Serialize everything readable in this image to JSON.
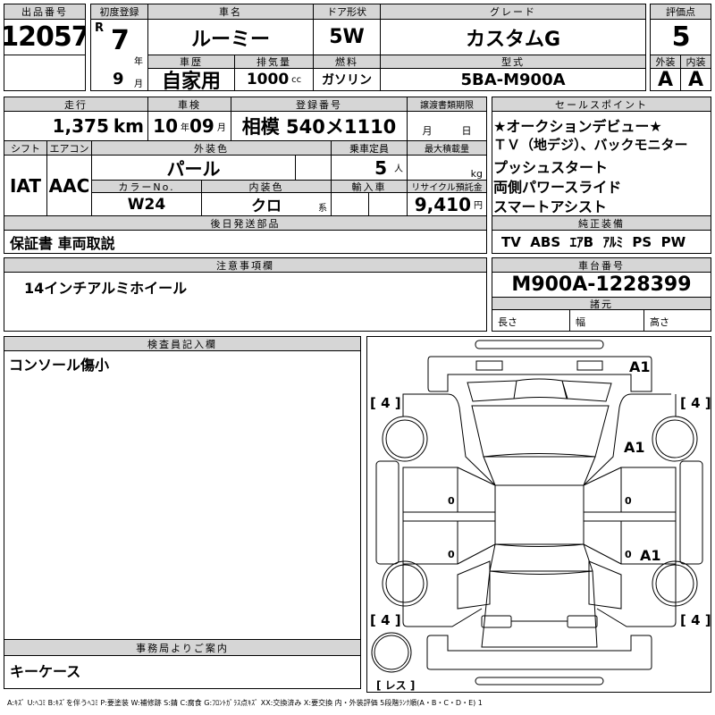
{
  "lot": {
    "label": "出品番号",
    "value": "12057"
  },
  "first_reg": {
    "label": "初度登録",
    "era": "R",
    "year": "7",
    "year_unit": "年",
    "month": "9",
    "month_unit": "月"
  },
  "car_name": {
    "label": "車名",
    "value": "ルーミー"
  },
  "door": {
    "label": "ドア形状",
    "value": "5W"
  },
  "grade": {
    "label": "グレード",
    "value": "カスタムG"
  },
  "history": {
    "label": "車歴",
    "value": "自家用"
  },
  "displacement": {
    "label": "排気量",
    "value": "1000",
    "unit": "cc"
  },
  "fuel": {
    "label": "燃料",
    "value": "ガソリン"
  },
  "model": {
    "label": "型式",
    "value": "5BA-M900A"
  },
  "score": {
    "label": "評価点",
    "value": "5",
    "ext_label": "外装",
    "int_label": "内装",
    "ext": "A",
    "int": "A"
  },
  "mileage": {
    "label": "走行",
    "value": "1,375",
    "unit": "km"
  },
  "inspection": {
    "label": "車検",
    "year": "10",
    "year_unit": "年",
    "month": "09",
    "month_unit": "月"
  },
  "plate": {
    "label": "登録番号",
    "value": "相模 540メ1110"
  },
  "transfer": {
    "label": "譲渡書類期限",
    "month_unit": "月",
    "day_unit": "日"
  },
  "shift": {
    "label": "シフト",
    "value": "IAT"
  },
  "aircon": {
    "label": "エアコン",
    "value": "AAC"
  },
  "ext_color": {
    "label": "外装色",
    "value": "パール"
  },
  "capacity": {
    "label": "乗車定員",
    "value": "5",
    "unit": "人"
  },
  "max_load": {
    "label": "最大積載量",
    "unit": "kg"
  },
  "color_no": {
    "label": "カラーNo.",
    "value": "W24"
  },
  "int_color": {
    "label": "内装色",
    "value": "クロ",
    "unit": "系"
  },
  "import": {
    "label": "輸入車"
  },
  "recycle": {
    "label": "リサイクル預託金",
    "value": "9,410",
    "unit": "円"
  },
  "later_parts": {
    "label": "後日発送部品",
    "value": "保証書 車両取説"
  },
  "sales_points": {
    "label": "セールスポイント",
    "items": [
      "★オークションデビュー★",
      "ＴＶ（地デジ）、バックモニター",
      "プッシュスタート",
      "両側パワースライド",
      "スマートアシスト"
    ]
  },
  "equipment": {
    "label": "純正装備",
    "value": "TV  ABS  ｴｱB  ｱﾙﾐ  PS  PW"
  },
  "notes": {
    "label": "注意事項欄",
    "value": "14インチアルミホイール"
  },
  "chassis": {
    "label": "車台番号",
    "value": "M900A-1228399"
  },
  "specs": {
    "label": "諸元",
    "length": "長さ",
    "width": "幅",
    "height": "高さ"
  },
  "inspector": {
    "label": "検査員記入欄",
    "value": "コンソール傷小"
  },
  "office": {
    "label": "事務局よりご案内",
    "value": "キーケース"
  },
  "diagram": {
    "fl": "[ 4 ]",
    "fr": "[ 4 ]",
    "rl": "[ 4 ]",
    "rr": "[ 4 ]",
    "spare": "[ レス ]",
    "a1_front": "A1",
    "a1_fender": "A1",
    "a1_rear_door": "A1",
    "zero": "0"
  },
  "footer": "A:ｷｽﾞ U:ﾍｺﾐ B:ｷｽﾞを伴うﾍｺﾐ P:要塗装 W:補修跡 S:錆 C:腐食 G:ﾌﾛﾝﾄｶﾞﾗｽ点ｷｽﾞ XX:交換済み X:要交換  内・外装評価  5段階ﾗﾝｸ順(A・B・C・D・E) 1"
}
